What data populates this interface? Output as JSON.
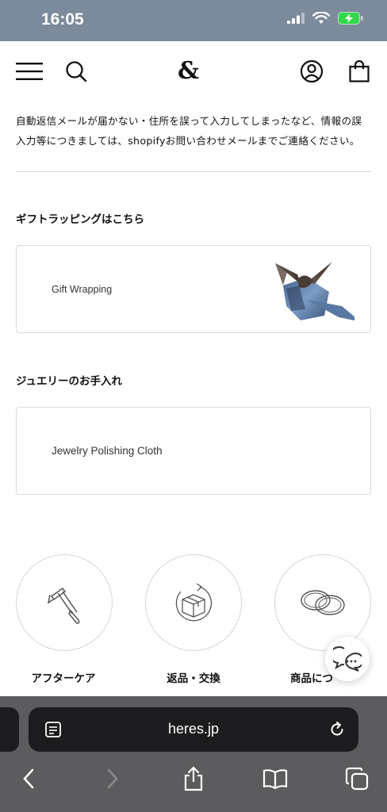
{
  "status_bar": {
    "time": "16:05"
  },
  "header": {
    "logo": "&"
  },
  "notice": {
    "line1": "自動返信メールが届かない・住所を誤って入力してしまったなど、情報の誤",
    "line2": "入力等につきましては、shopifyお問い合わせメールまでご連絡ください。"
  },
  "gift_section": {
    "title": "ギフトラッピングはこちら",
    "card_label": "Gift Wrapping"
  },
  "jewelry_section": {
    "title": "ジュエリーのお手入れ",
    "card_label": "Jewelry Polishing Cloth"
  },
  "service_links": [
    {
      "label": "アフターケア",
      "icon": "hammer-icon"
    },
    {
      "label": "返品・交換",
      "icon": "box-return-icon"
    },
    {
      "label": "商品につ",
      "icon": "rings-icon"
    }
  ],
  "browser": {
    "url": "heres.jp"
  },
  "colors": {
    "status_bar": "#7c8b9c",
    "browser_bar": "#5c5c5e",
    "url_bar": "#1c1c1e"
  }
}
